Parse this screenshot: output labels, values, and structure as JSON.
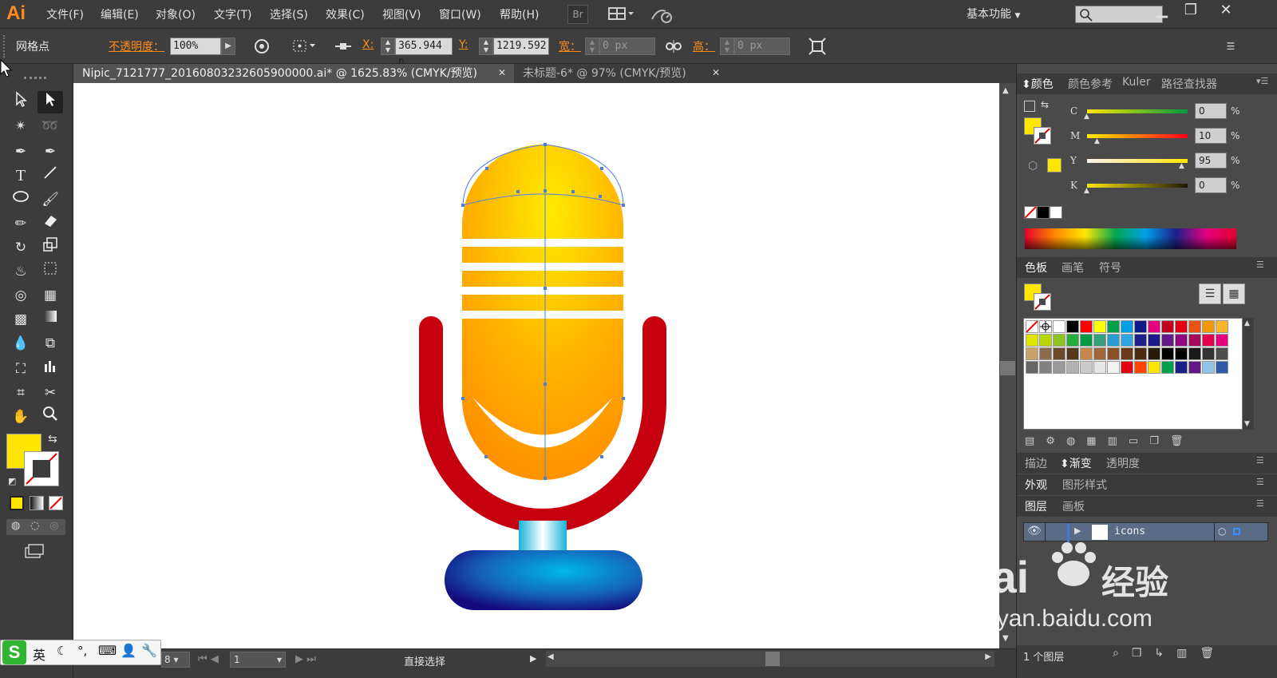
{
  "app": {
    "logo": "Ai"
  },
  "menu": [
    "文件(F)",
    "编辑(E)",
    "对象(O)",
    "文字(T)",
    "选择(S)",
    "效果(C)",
    "视图(V)",
    "窗口(W)",
    "帮助(H)"
  ],
  "menubar": {
    "bridge_label": "Br",
    "workspace_label": "基本功能",
    "search_placeholder": ""
  },
  "control_bar": {
    "selection_type": "网格点",
    "opacity_label": "不透明度：",
    "opacity_value": "100%",
    "x_label": "X:",
    "x_value": "365.944 p",
    "y_label": "Y:",
    "y_value": "1219.592",
    "w_label": "宽：",
    "w_value": "0 px",
    "h_label": "高：",
    "h_value": "0 px"
  },
  "tabs": [
    {
      "label": "Nipic_7121777_20160803232605900000.ai* @ 1625.83% (CMYK/预览)",
      "active": true
    },
    {
      "label": "未标题-6* @ 97% (CMYK/预览)",
      "active": false
    }
  ],
  "status": {
    "zoom_value": "8",
    "artboard_value": "1",
    "tool_status": "直接选择"
  },
  "color_panel": {
    "tabs": [
      "颜色",
      "颜色参考",
      "Kuler",
      "路径查找器"
    ],
    "channels": [
      {
        "label": "C",
        "value": "0",
        "unit": "%"
      },
      {
        "label": "M",
        "value": "10",
        "unit": "%"
      },
      {
        "label": "Y",
        "value": "95",
        "unit": "%"
      },
      {
        "label": "K",
        "value": "0",
        "unit": "%"
      }
    ],
    "fill_color": "#ffe600"
  },
  "swatches_panel": {
    "tabs": [
      "色板",
      "画笔",
      "符号"
    ],
    "colors": [
      "#ffffff",
      "#000000",
      "#ff0000",
      "#ffff00",
      "#00a04b",
      "#00a0e9",
      "#0d1a8a",
      "#e4007f",
      "#c0001d",
      "#e60012",
      "#ea5413",
      "#f39800",
      "#f8b62d",
      "#dfe600",
      "#b5d900",
      "#8fc31f",
      "#22ac38",
      "#009944",
      "#33a07b",
      "#2c9cce",
      "#2ea7e0",
      "#1d2088",
      "#1a1a8a",
      "#601986",
      "#920783",
      "#a40b5d",
      "#e4004f",
      "#e4007f",
      "#c9a16b",
      "#8c6d4b",
      "#6b4a2b",
      "#553a1e",
      "#c5894d",
      "#a0683a",
      "#8a5028",
      "#6b3a1a",
      "#4a2a10",
      "#2a1a08",
      "#000000",
      "#000000",
      "#1a1a1a",
      "#333333",
      "#4d4d4d",
      "#666666",
      "#808080",
      "#999999",
      "#b3b3b3",
      "#cccccc",
      "#e6e6e6",
      "#f2f2f2",
      "#e60012",
      "#ff4500",
      "#ffe600",
      "#00a04b",
      "#1d2088",
      "#601986",
      "#8ec5e8",
      "#2e5aa8"
    ]
  },
  "stroke_panel": {
    "tabs": [
      "描边",
      "渐变",
      "透明度"
    ]
  },
  "appearance_panel": {
    "tabs": [
      "外观",
      "图形样式"
    ]
  },
  "layers_panel": {
    "tabs": [
      "图层",
      "画板"
    ],
    "layer_name": "icons",
    "footer": "1 个图层"
  },
  "ime": {
    "lang": "英"
  },
  "watermark": {
    "brand": "Bai",
    "brand_cn": "经验",
    "url": "jingyan.baidu.com"
  }
}
